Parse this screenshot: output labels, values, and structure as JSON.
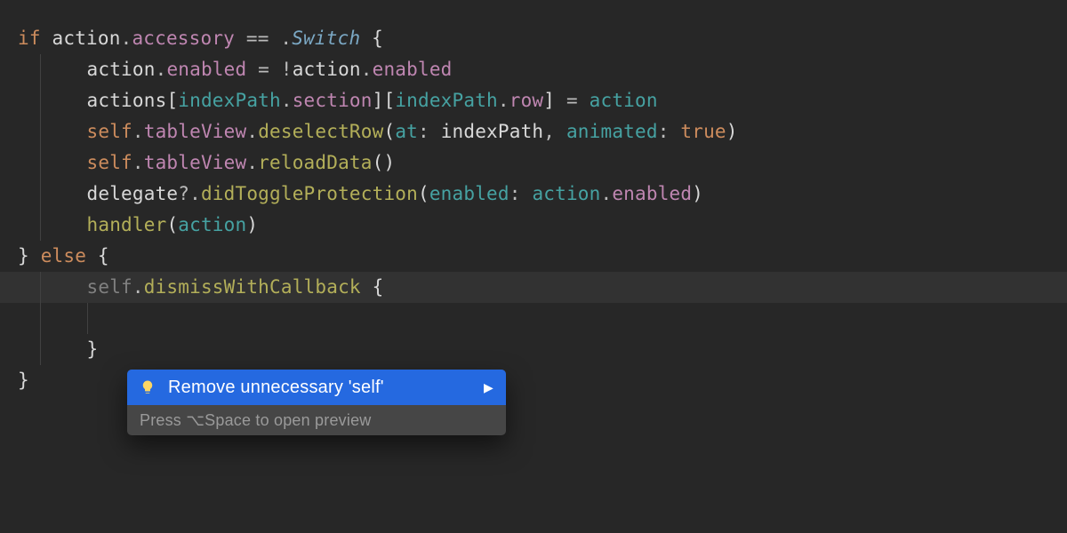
{
  "code": {
    "line1": {
      "kw_if": "if",
      "ident": "action",
      "dot": ".",
      "prop": "accessory",
      "eq": " == ",
      "enum_dot": ".",
      "enum_case": "Switch",
      "space_open": " {"
    },
    "line2": {
      "ident": "action",
      "dot": ".",
      "prop": "enabled",
      "assign": " = ",
      "bang": "!",
      "ident2": "action",
      "dot2": ".",
      "prop2": "enabled"
    },
    "line3": {
      "arr": "actions",
      "b1": "[",
      "ip1": "indexPath",
      "dot1": ".",
      "sec": "section",
      "b2": "][",
      "ip2": "indexPath",
      "dot2": ".",
      "row": "row",
      "b3": "]",
      "assign": " = ",
      "val": "action"
    },
    "line4": {
      "self": "self",
      "dot1": ".",
      "tv": "tableView",
      "dot2": ".",
      "call": "deselectRow",
      "paren": "(",
      "p1": "at",
      "colon1": ": ",
      "arg1": "indexPath",
      "comma": ", ",
      "p2": "animated",
      "colon2": ": ",
      "arg2": "true",
      "close": ")"
    },
    "line5": {
      "self": "self",
      "dot1": ".",
      "tv": "tableView",
      "dot2": ".",
      "call": "reloadData",
      "paren": "()"
    },
    "line6": {
      "delegate": "delegate",
      "q": "?.",
      "call": "didToggleProtection",
      "paren": "(",
      "p1": "enabled",
      "colon": ": ",
      "arg_a": "action",
      "dot": ".",
      "arg_b": "enabled",
      "close": ")"
    },
    "line7": {
      "fn": "handler",
      "paren": "(",
      "arg": "action",
      "close": ")"
    },
    "line8": {
      "close": "}",
      "sp": " ",
      "kw_else": "else",
      "open": " {"
    },
    "line9": {
      "self": "self",
      "dot": ".",
      "call": "dismissWithCallback",
      "open": " {"
    },
    "line10_empty": "",
    "line11": {
      "close": "}"
    },
    "line12": {
      "close": "}"
    }
  },
  "popup": {
    "action_label": "Remove unnecessary 'self'",
    "hint": "Press ⌥Space to open preview",
    "icon": "lightbulb-icon",
    "submenu_icon": "chevron-right-icon"
  }
}
